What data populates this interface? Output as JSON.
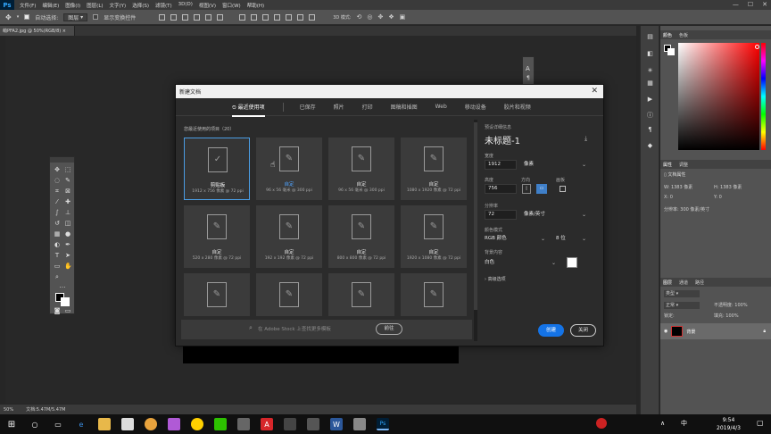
{
  "menubar": {
    "logo": "Ps",
    "items": [
      "文件(F)",
      "编辑(E)",
      "图像(I)",
      "图层(L)",
      "文字(Y)",
      "选择(S)",
      "滤镜(T)",
      "3D(D)",
      "视图(V)",
      "窗口(W)",
      "帮助(H)"
    ],
    "controls": [
      "—",
      "☐",
      "✕"
    ]
  },
  "optionsbar": {
    "auto_select_label": "自动选择:",
    "auto_select_value": "图层",
    "show_transform_label": "显示变换控件"
  },
  "document_tab": {
    "label": "萌PFA2.jpg @ 50%(RGB/8)"
  },
  "statusbar": {
    "zoom": "50%",
    "doc": "文档:5.47M/5.47M"
  },
  "dialog": {
    "title": "新建文档",
    "close": "✕",
    "tabs": [
      "最近使用项",
      "已保存",
      "照片",
      "打印",
      "图稿和插图",
      "Web",
      "移动设备",
      "胶片和视频"
    ],
    "section_title": "您最近使用的项目（20）",
    "cards": [
      {
        "name": "剪贴板",
        "size": "1912 x 756 像素 @ 72 ppi",
        "selected": true
      },
      {
        "name": "自定",
        "size": "96 x 56 毫米 @ 300 ppi",
        "selected": false
      },
      {
        "name": "自定",
        "size": "96 x 56 毫米 @ 300 ppi",
        "selected": false
      },
      {
        "name": "自定",
        "size": "1080 x 1920 像素 @ 72 ppi",
        "selected": false
      },
      {
        "name": "自定",
        "size": "520 x 280 像素 @ 72 ppi",
        "selected": false
      },
      {
        "name": "自定",
        "size": "192 x 192 像素 @ 72 ppi",
        "selected": false
      },
      {
        "name": "自定",
        "size": "800 x 800 像素 @ 72 ppi",
        "selected": false
      },
      {
        "name": "自定",
        "size": "1920 x 1080 像素 @ 72 ppi",
        "selected": false
      },
      {
        "name": "",
        "size": "",
        "selected": false
      },
      {
        "name": "",
        "size": "",
        "selected": false
      },
      {
        "name": "",
        "size": "",
        "selected": false
      },
      {
        "name": "",
        "size": "",
        "selected": false
      }
    ],
    "stock_placeholder": "在 Adobe Stock 上查找更多模板",
    "go_button": "前往",
    "details": {
      "header": "预设详细信息",
      "doc_name": "未标题-1",
      "width_label": "宽度",
      "width_value": "1912",
      "width_unit": "像素",
      "height_label": "高度",
      "height_value": "756",
      "orientation_label": "方向",
      "artboard_label": "画板",
      "resolution_label": "分辨率",
      "resolution_value": "72",
      "resolution_unit": "像素/英寸",
      "color_mode_label": "颜色模式",
      "color_mode_value": "RGB 颜色",
      "bit_depth": "8 位",
      "background_label": "背景内容",
      "background_value": "白色",
      "advanced": "高级选项"
    },
    "create_button": "创建",
    "close_button": "关闭"
  },
  "right_panels": {
    "color_tabs": [
      "颜色",
      "色板"
    ],
    "properties_tabs": [
      "属性",
      "调整"
    ],
    "doc_props": "文档属性",
    "w_label": "W:",
    "w_value": "1383 像素",
    "h_label": "H:",
    "h_value": "1383 像素",
    "x_label": "X:",
    "x_value": "0",
    "y_label": "Y:",
    "y_value": "0",
    "resolution_text": "分辨率: 300 像素/英寸",
    "layers_tabs": [
      "图层",
      "通道",
      "路径"
    ],
    "layer_kind": "类型",
    "blend_mode": "正常",
    "opacity_label": "不透明度:",
    "opacity_value": "100%",
    "lock_label": "锁定:",
    "fill_label": "填充:",
    "fill_value": "100%",
    "layer_name": "背景"
  },
  "taskbar": {
    "time": "9:54",
    "date": "2019/4/3",
    "ime": "中"
  },
  "colors": {
    "accent": "#1473e6",
    "selected_border": "#4b9de3"
  }
}
